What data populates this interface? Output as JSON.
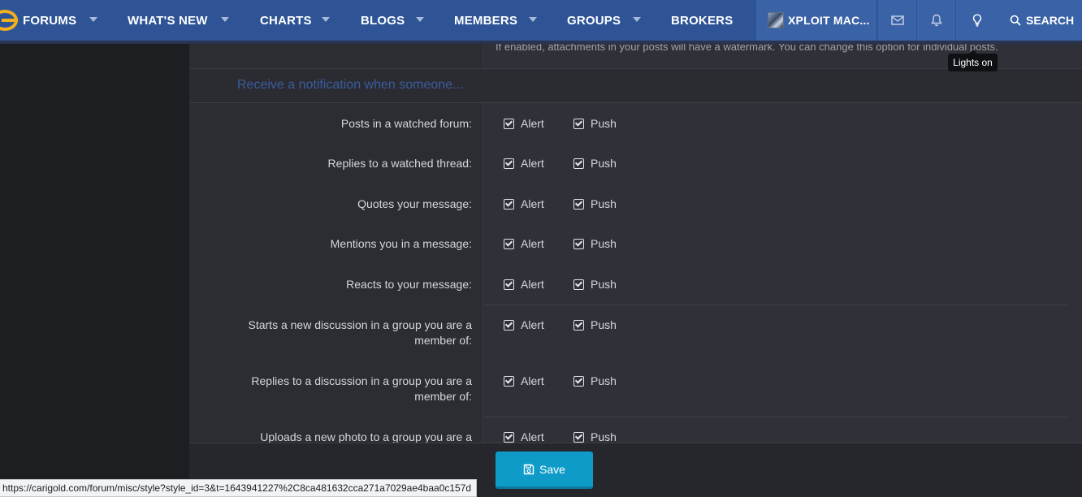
{
  "nav": {
    "items": [
      {
        "label": "FORUMS"
      },
      {
        "label": "WHAT'S NEW"
      },
      {
        "label": "CHARTS"
      },
      {
        "label": "BLOGS"
      },
      {
        "label": "MEMBERS"
      },
      {
        "label": "GROUPS"
      },
      {
        "label": "BROKERS"
      }
    ],
    "username": "XPLOIT MAC...",
    "search_label": "SEARCH"
  },
  "tooltip": "Lights on",
  "watermark_note": "If enabled, attachments in your posts will have a watermark. You can change this option for individual posts.",
  "section_title": "Receive a notification when someone...",
  "options": [
    {
      "label": "Posts in a watched forum:",
      "alert": "Alert",
      "push": "Push"
    },
    {
      "label": "Replies to a watched thread:",
      "alert": "Alert",
      "push": "Push"
    },
    {
      "label": "Quotes your message:",
      "alert": "Alert",
      "push": "Push"
    },
    {
      "label": "Mentions you in a message:",
      "alert": "Alert",
      "push": "Push"
    },
    {
      "label": "Reacts to your message:",
      "alert": "Alert",
      "push": "Push"
    },
    {
      "label": "Starts a new discussion in a group you are a member of:",
      "alert": "Alert",
      "push": "Push"
    },
    {
      "label": "Replies to a discussion in a group you are a member of:",
      "alert": "Alert",
      "push": "Push"
    },
    {
      "label": "Uploads a new photo to a group you are a",
      "alert": "Alert",
      "push": "Push"
    }
  ],
  "save_label": "Save",
  "status_url": "https://carigold.com/forum/misc/style?style_id=3&t=1643941227%2C8ca481632cca271a7029ae4baa0c157d",
  "colors": {
    "nav_bg": "#2e5496",
    "accent_save": "#0e9bc8",
    "logo": "#f2b01e"
  }
}
